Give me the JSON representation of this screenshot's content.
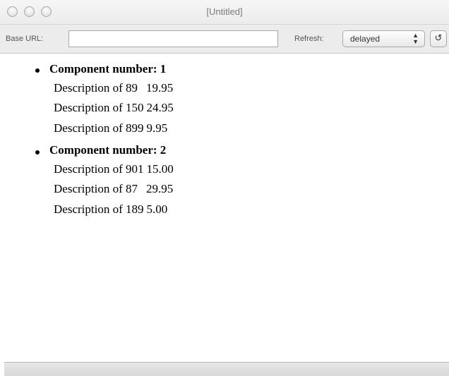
{
  "window": {
    "title": "[Untitled]"
  },
  "toolbar": {
    "base_url_label": "Base URL:",
    "base_url_value": "",
    "refresh_label": "Refresh:",
    "refresh_value": "delayed",
    "refresh_icon": "↺"
  },
  "components": [
    {
      "heading": "Component number: 1",
      "items": [
        {
          "description": "Description of 89",
          "price": "19.95"
        },
        {
          "description": "Description of 150",
          "price": "24.95"
        },
        {
          "description": "Description of 899",
          "price": "9.95"
        }
      ]
    },
    {
      "heading": "Component number: 2",
      "items": [
        {
          "description": "Description of 901",
          "price": "15.00"
        },
        {
          "description": "Description of 87",
          "price": "29.95"
        },
        {
          "description": "Description of 189",
          "price": "5.00"
        }
      ]
    }
  ]
}
